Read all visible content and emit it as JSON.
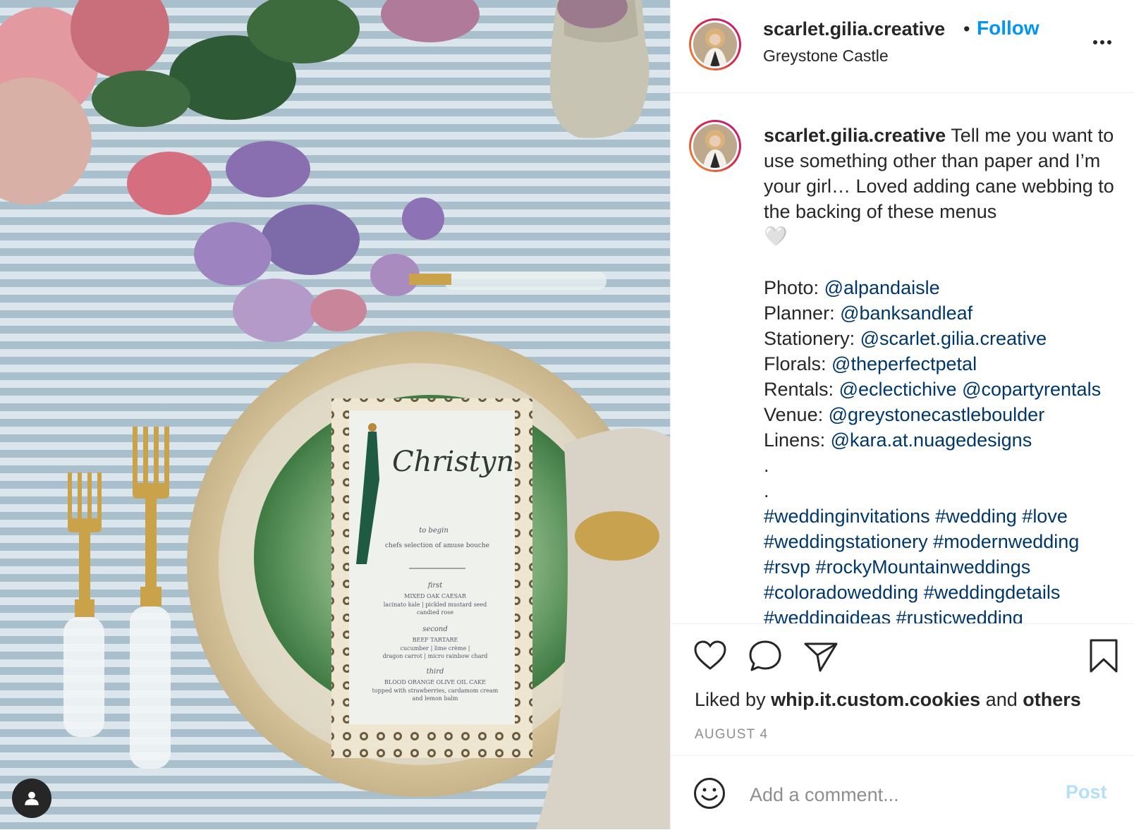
{
  "post": {
    "username": "scarlet.gilia.creative",
    "dot": "•",
    "follow_label": "Follow",
    "location": "Greystone Castle",
    "more_icon": "more-horizontal-icon"
  },
  "caption": {
    "username": "scarlet.gilia.creative",
    "text": "Tell me you want to use something other than paper and I’m your girl… Loved adding cane webbing to the backing of these menus",
    "emoji": "🤍",
    "credits": [
      {
        "label": "Photo:",
        "handles": [
          "@alpandaisle"
        ]
      },
      {
        "label": "Planner:",
        "handles": [
          "@banksandleaf"
        ]
      },
      {
        "label": "Stationery:",
        "handles": [
          "@scarlet.gilia.creative"
        ]
      },
      {
        "label": "Florals:",
        "handles": [
          "@theperfectpetal"
        ]
      },
      {
        "label": "Rentals:",
        "handles": [
          "@eclectichive",
          "@copartyrentals"
        ]
      },
      {
        "label": "Venue:",
        "handles": [
          "@greystonecastleboulder"
        ]
      },
      {
        "label": "Linens:",
        "handles": [
          "@kara.at.nuagedesigns"
        ]
      }
    ],
    "dots": [
      ".",
      "."
    ],
    "hashtags": [
      "#weddinginvitations",
      "#wedding",
      "#love",
      "#weddingstationery",
      "#modernwedding",
      "#rsvp",
      "#rockyMountainweddings",
      "#coloradowedding",
      "#weddingdetails",
      "#weddingideas",
      "#rusticwedding"
    ]
  },
  "actions": {
    "liked_prefix": "Liked by",
    "liked_user": "whip.it.custom.cookies",
    "liked_and": "and",
    "liked_others": "others",
    "date": "AUGUST 4"
  },
  "comment": {
    "placeholder": "Add a comment...",
    "post_label": "Post"
  },
  "menu_card": {
    "name": "Christyn",
    "course1_label": "to begin",
    "course1_text": "chefs selection of amuse bouche",
    "course2_label": "first",
    "course2_title": "MIXED OAK CAESAR",
    "course2_text": "lacinato kale | pickled mustard seed",
    "course2_text2": "candied rose",
    "course3_label": "second",
    "course3_title": "BEEF TARTARE",
    "course3_text": "cucumber | lime crème |",
    "course3_text2": "dragon carrot | micro rainbow chard",
    "course4_label": "third",
    "course4_title": "BLOOD ORANGE OLIVE OIL CAKE",
    "course4_text": "topped with strawberries, cardamom cream",
    "course4_text2": "and lemon balm"
  },
  "colors": {
    "accent": "#0095f6",
    "link": "#00376b",
    "muted": "#8e8e8e",
    "post_disabled": "#b2dffc"
  }
}
